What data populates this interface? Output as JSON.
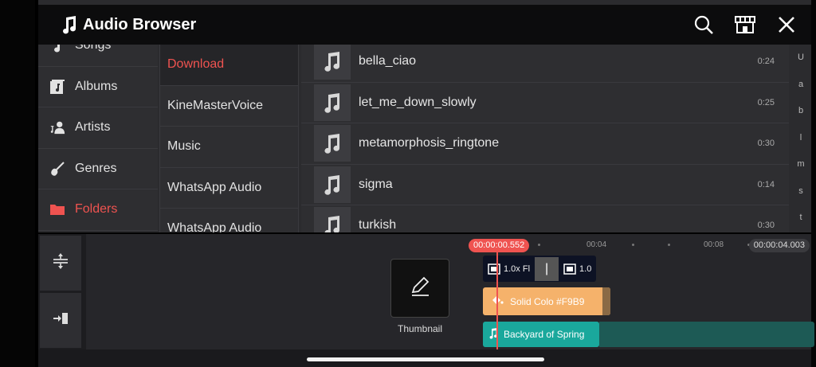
{
  "header": {
    "title": "Audio Browser"
  },
  "categories": [
    {
      "label": "Songs",
      "icon": "music-note-icon",
      "active": false
    },
    {
      "label": "Albums",
      "icon": "album-icon",
      "active": false
    },
    {
      "label": "Artists",
      "icon": "artist-icon",
      "active": false
    },
    {
      "label": "Genres",
      "icon": "guitar-icon",
      "active": false
    },
    {
      "label": "Folders",
      "icon": "folder-icon",
      "active": true
    }
  ],
  "folders": [
    {
      "label": "Download",
      "active": true
    },
    {
      "label": "KineMasterVoice",
      "active": false
    },
    {
      "label": "Music",
      "active": false
    },
    {
      "label": "WhatsApp Audio",
      "active": false
    },
    {
      "label": "WhatsApp Audio",
      "active": false
    }
  ],
  "songs": [
    {
      "name": "bella_ciao",
      "duration": "0:24"
    },
    {
      "name": "let_me_down_slowly",
      "duration": "0:25"
    },
    {
      "name": "metamorphosis_ringtone",
      "duration": "0:30"
    },
    {
      "name": "sigma",
      "duration": "0:14"
    },
    {
      "name": "turkish",
      "duration": "0:30"
    }
  ],
  "alphabet": [
    "U",
    "a",
    "b",
    "l",
    "m",
    "s",
    "t"
  ],
  "timeline": {
    "current_time": "00:00:00.552",
    "mark_1": "00:04",
    "mark_2": "00:08",
    "end_time": "00:00:04.003",
    "thumbnail_label": "Thumbnail",
    "video_clip_label_1": "1.0x Fl",
    "video_clip_label_2": "1.0",
    "solid_clip_label": "Solid Colo  #F9B9",
    "audio_clip_label": "Backyard of Spring"
  },
  "colors": {
    "accent": "#ef5350",
    "solid_clip": "#f5b26b",
    "audio_clip": "#1aa89c"
  }
}
